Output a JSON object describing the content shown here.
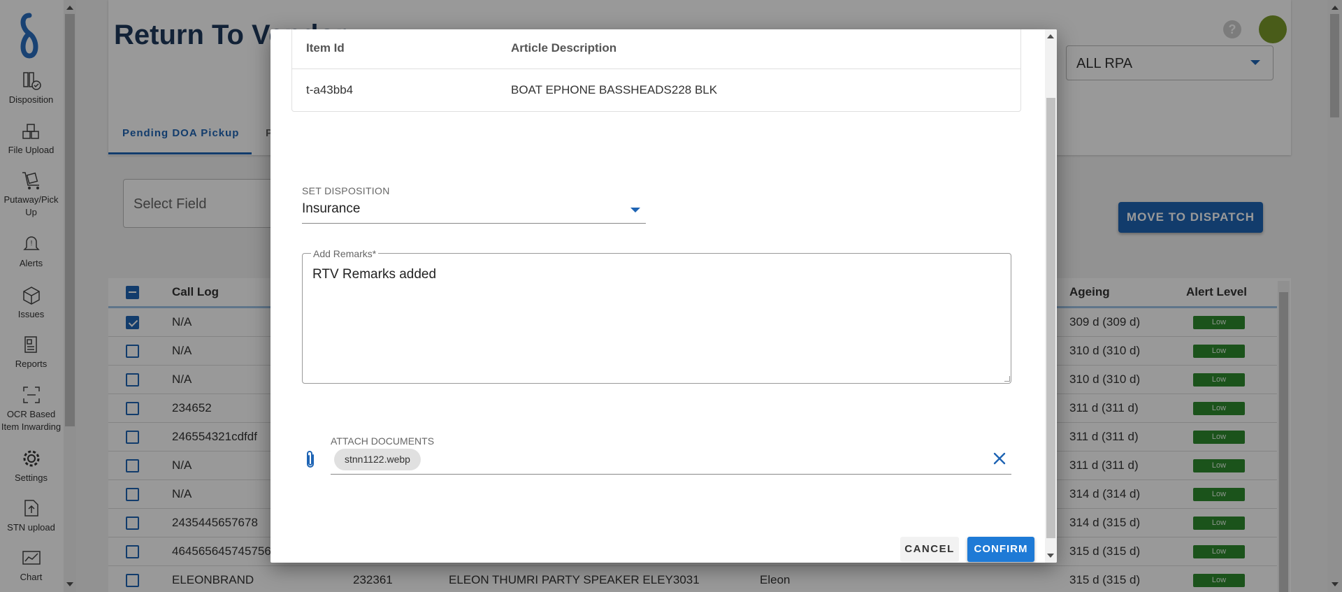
{
  "sidebar": {
    "items": [
      {
        "label": "Disposition",
        "icon": "books-check-icon"
      },
      {
        "label": "File Upload",
        "icon": "upload-boxes-icon"
      },
      {
        "label": "Putaway/Pick Up",
        "icon": "trolley-icon"
      },
      {
        "label": "Alerts",
        "icon": "bell-icon"
      },
      {
        "label": "Issues",
        "icon": "boxes-icon"
      },
      {
        "label": "Reports",
        "icon": "report-icon"
      },
      {
        "label": "OCR Based Item Inwarding",
        "icon": "scan-icon"
      },
      {
        "label": "Settings",
        "icon": "gear-icon"
      },
      {
        "label": "STN upload",
        "icon": "file-upload-icon"
      },
      {
        "label": "Chart",
        "icon": "chart-icon"
      }
    ]
  },
  "page": {
    "title": "Return To Vendor",
    "rpa_select": "ALL RPA",
    "tabs": [
      "Pending DOA Pickup",
      "P"
    ],
    "select_field_placeholder": "Select Field",
    "move_button": "MOVE TO DISPATCH"
  },
  "table": {
    "columns": {
      "call_log": "Call Log",
      "ageing": "Ageing",
      "alert_level": "Alert Level"
    },
    "rows": [
      {
        "call_log": "N/A",
        "c2": "",
        "c3": "",
        "c4": "",
        "ageing": "309 d (309 d)",
        "alert": "Low",
        "checked": true
      },
      {
        "call_log": "N/A",
        "c2": "",
        "c3": "",
        "c4": "",
        "ageing": "310 d (310 d)",
        "alert": "Low",
        "checked": false
      },
      {
        "call_log": "N/A",
        "c2": "",
        "c3": "",
        "c4": "",
        "ageing": "310 d (310 d)",
        "alert": "Low",
        "checked": false
      },
      {
        "call_log": "234652",
        "c2": "",
        "c3": "",
        "c4": "",
        "ageing": "311 d (311 d)",
        "alert": "Low",
        "checked": false
      },
      {
        "call_log": "246554321cdfdf",
        "c2": "",
        "c3": "",
        "c4": "",
        "ageing": "311 d (311 d)",
        "alert": "Low",
        "checked": false
      },
      {
        "call_log": "N/A",
        "c2": "",
        "c3": "",
        "c4": "",
        "ageing": "311 d (311 d)",
        "alert": "Low",
        "checked": false
      },
      {
        "call_log": "N/A",
        "c2": "",
        "c3": "",
        "c4": "",
        "ageing": "314 d (314 d)",
        "alert": "Low",
        "checked": false
      },
      {
        "call_log": "2435445657678",
        "c2": "",
        "c3": "",
        "c4": "",
        "ageing": "314 d (315 d)",
        "alert": "Low",
        "checked": false
      },
      {
        "call_log": "464565645745756",
        "c2": "",
        "c3": "",
        "c4": "",
        "ageing": "315 d (315 d)",
        "alert": "Low",
        "checked": false
      },
      {
        "call_log": "ELEONBRAND",
        "c2": "232361",
        "c3": "ELEON THUMRI PARTY SPEAKER ELEY3031",
        "c4": "Eleon",
        "ageing": "315 d (315 d)",
        "alert": "Low",
        "checked": false
      }
    ]
  },
  "modal": {
    "item_table": {
      "col_item_id": "Item Id",
      "col_article": "Article Description",
      "item_id": "t-a43bb4",
      "article": "BOAT EPHONE BASSHEADS228 BLK"
    },
    "disposition_label": "SET DISPOSITION",
    "disposition_value": "Insurance",
    "remarks_label": "Add Remarks*",
    "remarks_value": "RTV Remarks added",
    "attach_label": "ATTACH DOCUMENTS",
    "attached_file": "stnn1122.webp",
    "cancel": "CANCEL",
    "confirm": "CONFIRM"
  },
  "colors": {
    "primary": "#1e64b4",
    "alert_low": "#2e8b2e",
    "title": "#1e3a5c"
  }
}
